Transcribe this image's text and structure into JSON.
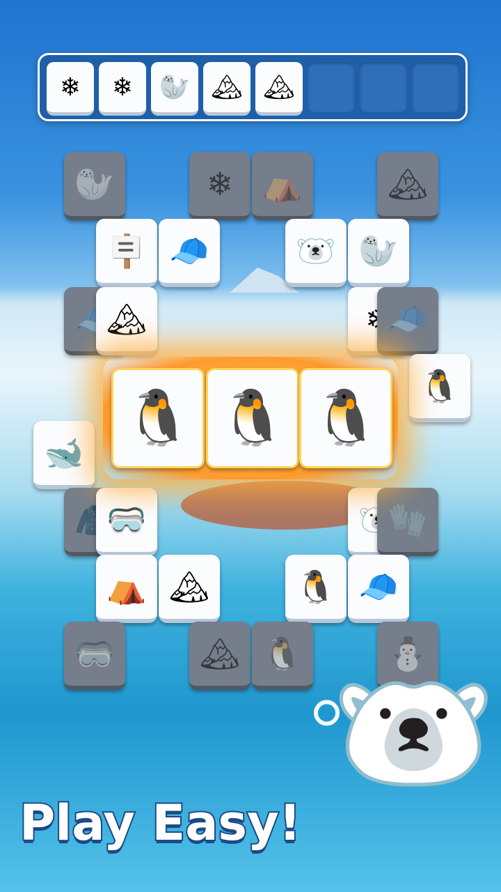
{
  "slot_bar": {
    "slots": [
      {
        "icon": "snowflake-icon",
        "glyph": "❄"
      },
      {
        "icon": "snowflake-icon",
        "glyph": "❄"
      },
      {
        "icon": "walrus-icon",
        "glyph": "🦭"
      },
      {
        "icon": "iceberg-icon",
        "glyph": "🏔"
      },
      {
        "icon": "iceberg-icon",
        "glyph": "🏔"
      },
      {
        "icon": "empty-slot",
        "glyph": ""
      },
      {
        "icon": "empty-slot",
        "glyph": ""
      },
      {
        "icon": "empty-slot",
        "glyph": ""
      }
    ]
  },
  "board": {
    "tiles": [
      {
        "icon": "walrus-icon",
        "glyph": "🦭",
        "dim": true
      },
      {
        "icon": "snowflake-icon",
        "glyph": "❄",
        "dim": true
      },
      {
        "icon": "igloo-icon",
        "glyph": "⛺",
        "dim": true
      },
      {
        "icon": "iceberg-icon",
        "glyph": "🏔",
        "dim": true
      },
      {
        "icon": "signpost-icon",
        "glyph": "🪧",
        "dim": false
      },
      {
        "icon": "beanie-hat-icon",
        "glyph": "🧢",
        "dim": false
      },
      {
        "icon": "polar-bear-icon",
        "glyph": "🐻‍❄️",
        "dim": false
      },
      {
        "icon": "walrus-icon",
        "glyph": "🦭",
        "dim": false
      },
      {
        "icon": "beanie-hat-icon",
        "glyph": "🧢",
        "dim": true
      },
      {
        "icon": "iceberg-icon",
        "glyph": "🏔",
        "dim": false
      },
      {
        "icon": "snowflake-icon",
        "glyph": "❄",
        "dim": false
      },
      {
        "icon": "beanie-hat-icon",
        "glyph": "🧢",
        "dim": true
      },
      {
        "icon": "penguin-icon",
        "glyph": "🐧",
        "dim": false
      },
      {
        "icon": "orca-icon",
        "glyph": "🐋",
        "dim": false
      },
      {
        "icon": "jacket-icon",
        "glyph": "🧥",
        "dim": true
      },
      {
        "icon": "ski-goggles-icon",
        "glyph": "🥽",
        "dim": false
      },
      {
        "icon": "polar-bear-icon",
        "glyph": "🐻‍❄️",
        "dim": false
      },
      {
        "icon": "glove-icon",
        "glyph": "🧤",
        "dim": true
      },
      {
        "icon": "igloo-icon",
        "glyph": "⛺",
        "dim": false
      },
      {
        "icon": "iceberg-icon",
        "glyph": "🏔",
        "dim": false
      },
      {
        "icon": "penguin-icon",
        "glyph": "🐧",
        "dim": false
      },
      {
        "icon": "beanie-hat-icon",
        "glyph": "🧢",
        "dim": false
      },
      {
        "icon": "ski-goggles-icon",
        "glyph": "🥽",
        "dim": true
      },
      {
        "icon": "iceberg-icon",
        "glyph": "🏔",
        "dim": true
      },
      {
        "icon": "penguin-icon",
        "glyph": "🐧",
        "dim": true
      },
      {
        "icon": "snowman-icon",
        "glyph": "⛄",
        "dim": true
      }
    ],
    "matched": [
      {
        "icon": "penguin-icon",
        "glyph": "🐧"
      },
      {
        "icon": "penguin-icon",
        "glyph": "🐧"
      },
      {
        "icon": "penguin-icon",
        "glyph": "🐧"
      }
    ]
  },
  "headline": "Play Easy!",
  "mascot": {
    "icon": "polar-bear-mascot-icon",
    "glyph": "🐻‍❄️",
    "snowball": "⚪"
  }
}
